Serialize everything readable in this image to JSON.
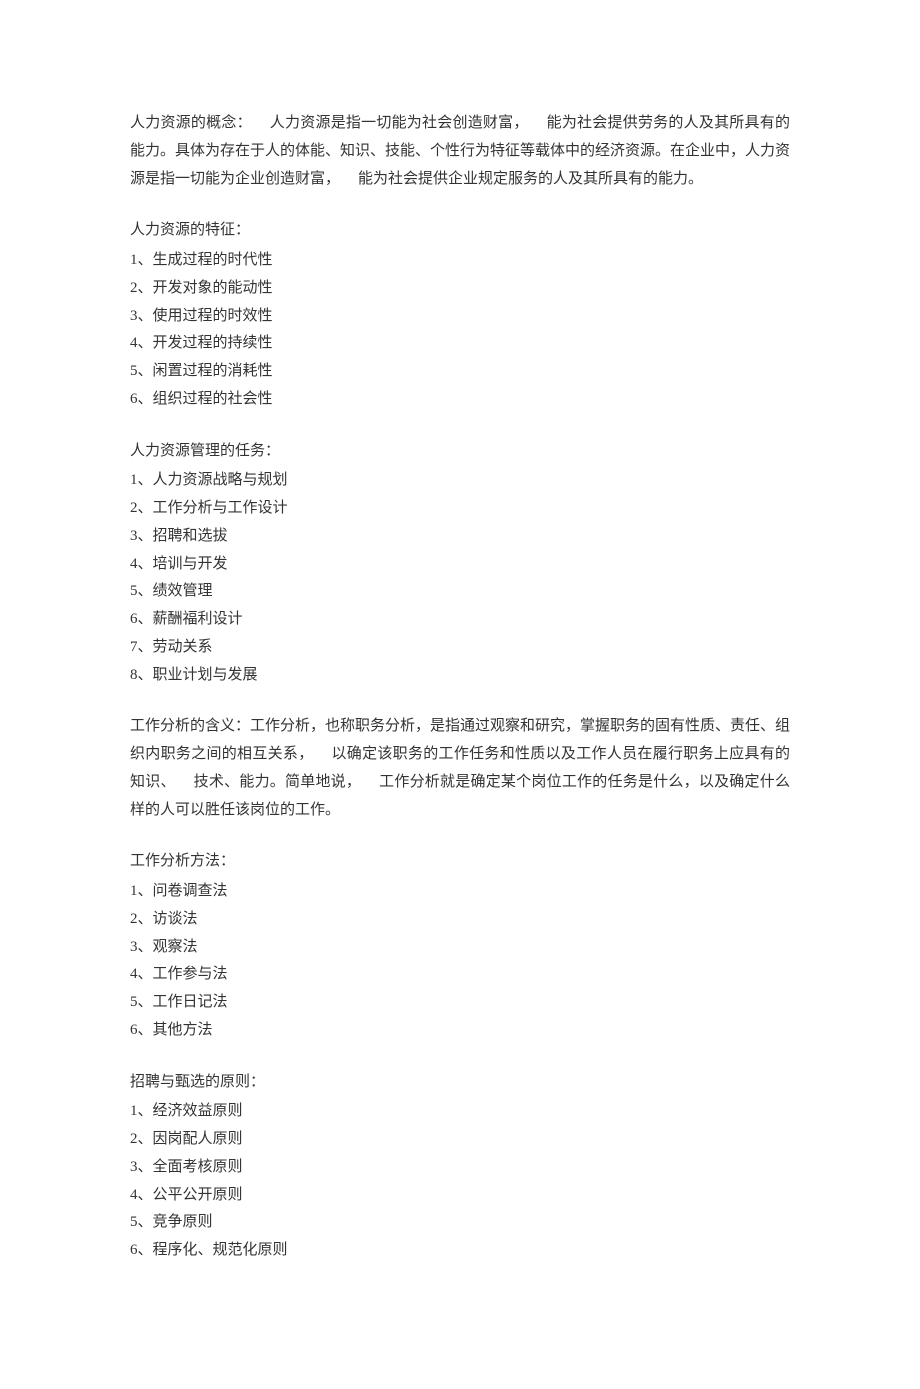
{
  "sections": [
    {
      "type": "paragraph",
      "parts": [
        "人力资源的概念：",
        "人力资源是指一切能为社会创造财富，",
        "能为社会提供劳务的人及其所具有的能力。具体为存在于人的体能、知识、技能、个性行为特征等载体中的经济资源。在企业中，人力资源是指一切能为企业创造财富，",
        "能为社会提供企业规定服务的人及其所具有的能力。"
      ]
    },
    {
      "type": "list",
      "heading": "人力资源的特征：",
      "items": [
        "1、生成过程的时代性",
        "2、开发对象的能动性",
        "3、使用过程的时效性",
        "4、开发过程的持续性",
        "5、闲置过程的消耗性",
        "6、组织过程的社会性"
      ]
    },
    {
      "type": "list",
      "heading": "人力资源管理的任务：",
      "items": [
        "1、人力资源战略与规划",
        "2、工作分析与工作设计",
        "3、招聘和选拔",
        "4、培训与开发",
        "5、绩效管理",
        "6、薪酬福利设计",
        "7、劳动关系",
        "8、职业计划与发展"
      ]
    },
    {
      "type": "paragraph",
      "parts": [
        "工作分析的含义：工作分析，也称职务分析，是指通过观察和研究，掌握职务的固有性质、责任、组织内职务之间的相互关系，",
        "以确定该职务的工作任务和性质以及工作人员在履行职务上应具有的知识、",
        "技术、能力。简单地说，",
        "工作分析就是确定某个岗位工作的任务是什么，以及确定什么样的人可以胜任该岗位的工作。"
      ]
    },
    {
      "type": "list",
      "heading": "工作分析方法：",
      "items": [
        "1、问卷调查法",
        "2、访谈法",
        "3、观察法",
        "4、工作参与法",
        "5、工作日记法",
        "6、其他方法"
      ]
    },
    {
      "type": "list",
      "heading": "招聘与甄选的原则：",
      "items": [
        "1、经济效益原则",
        "2、因岗配人原则",
        "3、全面考核原则",
        "4、公平公开原则",
        "5、竞争原则",
        "6、程序化、规范化原则"
      ]
    }
  ]
}
